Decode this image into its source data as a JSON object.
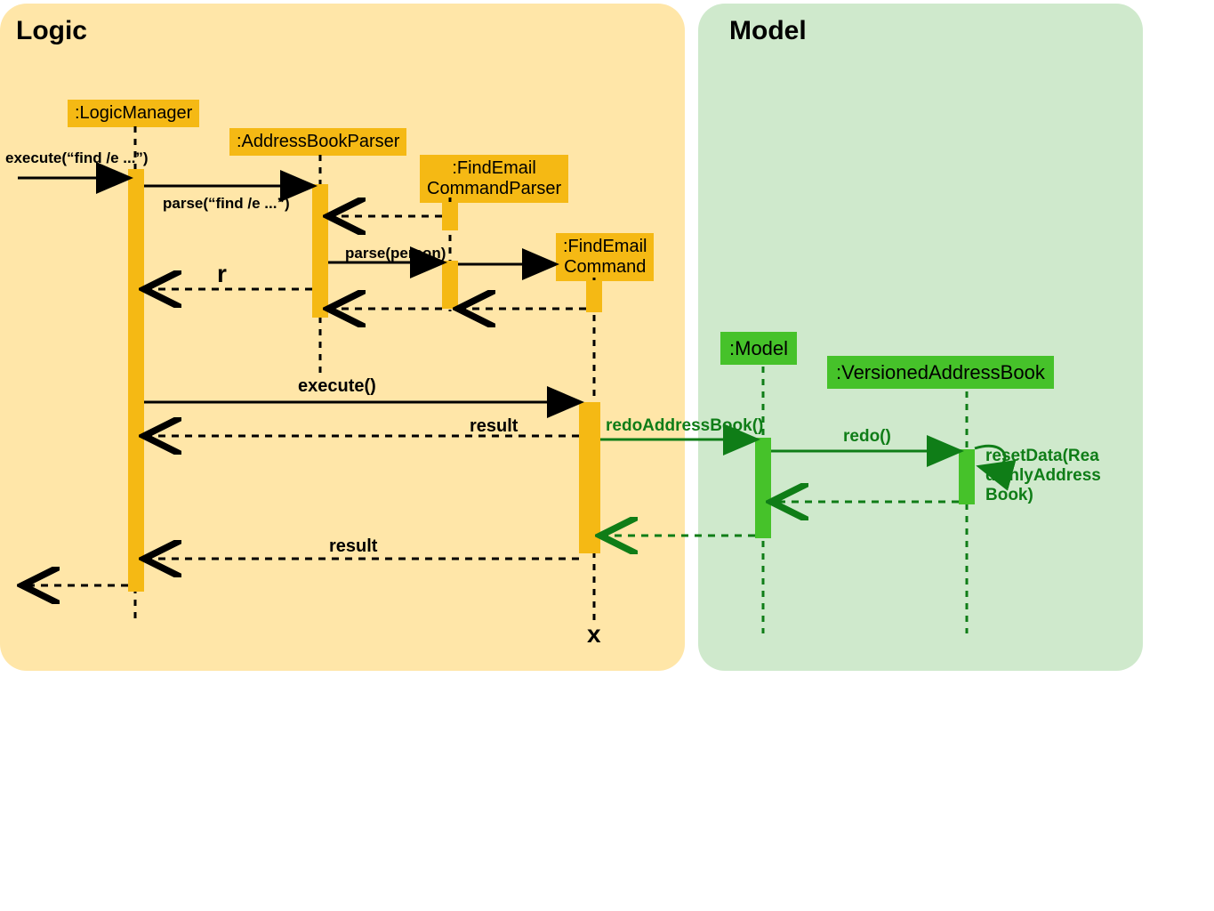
{
  "logic": {
    "title": "Logic",
    "objects": {
      "logicManager": ":LogicManager",
      "addressBookParser": ":AddressBookParser",
      "findEmailCommandParser": ":FindEmail\nCommandParser",
      "findEmailCommand": ":FindEmail\nCommand"
    },
    "messages": {
      "execute_find": "execute(“find /e ...”)",
      "parse_find": "parse(“find /e ...”)",
      "parse_person": "parse(person)",
      "r": "r",
      "execute": "execute()",
      "result_1": "result",
      "result_2": "result",
      "destroy": "x"
    }
  },
  "model": {
    "title": "Model",
    "objects": {
      "model": ":Model",
      "versioned": ":VersionedAddressBook"
    },
    "messages": {
      "redoAddressBook": "redoAddressBook()",
      "redo": "redo()",
      "resetData": "resetData(Rea\ndOnlyAddress\nBook)"
    }
  },
  "chart_data": {
    "type": "sequence-diagram",
    "participants": [
      {
        "name": ":LogicManager",
        "group": "Logic"
      },
      {
        "name": ":AddressBookParser",
        "group": "Logic"
      },
      {
        "name": ":FindEmailCommandParser",
        "group": "Logic"
      },
      {
        "name": ":FindEmailCommand",
        "group": "Logic"
      },
      {
        "name": ":Model",
        "group": "Model"
      },
      {
        "name": ":VersionedAddressBook",
        "group": "Model"
      }
    ],
    "messages": [
      {
        "from": "caller",
        "to": ":LogicManager",
        "label": "execute(\"find /e ...\")",
        "type": "call"
      },
      {
        "from": ":LogicManager",
        "to": ":AddressBookParser",
        "label": "parse(\"find /e ...\")",
        "type": "call"
      },
      {
        "from": ":AddressBookParser",
        "to": ":FindEmailCommandParser",
        "label": "",
        "type": "create"
      },
      {
        "from": ":FindEmailCommandParser",
        "to": ":AddressBookParser",
        "label": "",
        "type": "return"
      },
      {
        "from": ":AddressBookParser",
        "to": ":FindEmailCommandParser",
        "label": "parse(person)",
        "type": "call"
      },
      {
        "from": ":FindEmailCommandParser",
        "to": ":FindEmailCommand",
        "label": "",
        "type": "create"
      },
      {
        "from": ":FindEmailCommand",
        "to": ":FindEmailCommandParser",
        "label": "",
        "type": "return"
      },
      {
        "from": ":FindEmailCommandParser",
        "to": ":AddressBookParser",
        "label": "",
        "type": "return"
      },
      {
        "from": ":AddressBookParser",
        "to": ":LogicManager",
        "label": "r",
        "type": "return"
      },
      {
        "from": ":LogicManager",
        "to": ":FindEmailCommand",
        "label": "execute()",
        "type": "call"
      },
      {
        "from": ":FindEmailCommand",
        "to": ":Model",
        "label": "redoAddressBook()",
        "type": "call"
      },
      {
        "from": ":Model",
        "to": ":VersionedAddressBook",
        "label": "redo()",
        "type": "call"
      },
      {
        "from": ":VersionedAddressBook",
        "to": ":VersionedAddressBook",
        "label": "resetData(ReadOnlyAddressBook)",
        "type": "self"
      },
      {
        "from": ":VersionedAddressBook",
        "to": ":Model",
        "label": "",
        "type": "return"
      },
      {
        "from": ":Model",
        "to": ":FindEmailCommand",
        "label": "",
        "type": "return"
      },
      {
        "from": ":FindEmailCommand",
        "to": ":LogicManager",
        "label": "result",
        "type": "return"
      },
      {
        "from": ":FindEmailCommand",
        "to": ":LogicManager",
        "label": "result",
        "type": "return"
      },
      {
        "from": ":LogicManager",
        "to": "caller",
        "label": "",
        "type": "return"
      },
      {
        "participant": ":FindEmailCommand",
        "type": "destroy"
      }
    ]
  }
}
